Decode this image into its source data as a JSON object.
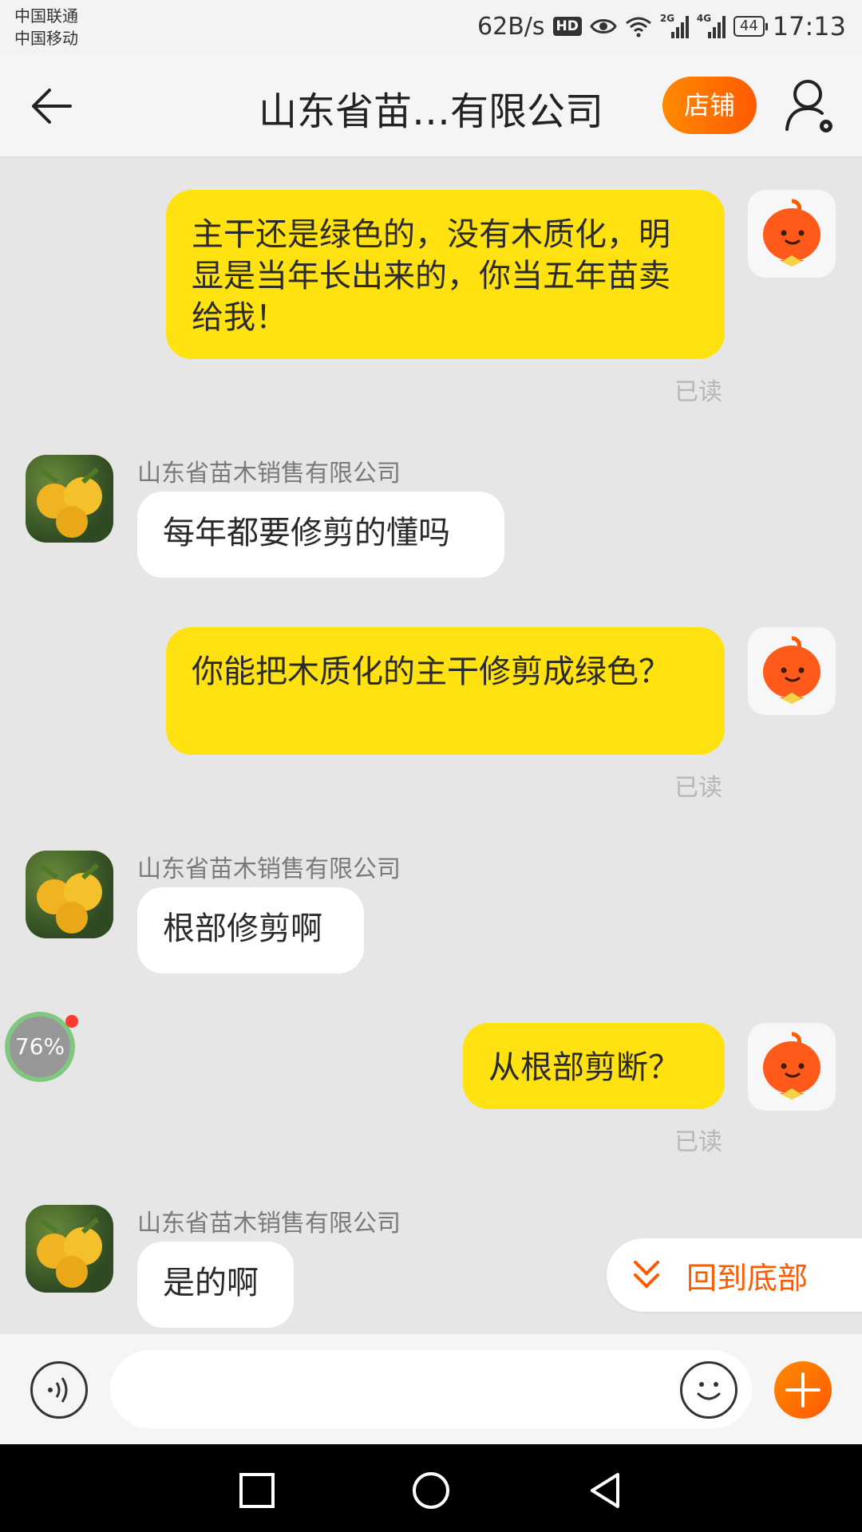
{
  "status_bar": {
    "carrier_1": "中国联通",
    "carrier_2": "中国移动",
    "net_speed": "62B/s",
    "hd_badge": "HD",
    "sig_tag_2g": "2G",
    "sig_tag_4g": "4G",
    "battery_level": "44",
    "time": "17:13"
  },
  "header": {
    "title": "山东省苗…有限公司",
    "shop_button": "店铺",
    "icons": {
      "back": "arrow-left",
      "user_settings": "user-gear"
    }
  },
  "chat": {
    "messages": [
      {
        "from": "self",
        "text": "主干还是绿色的，没有木质化，明显是当年长出来的，你当五年苗卖给我！",
        "status": "已读"
      },
      {
        "from": "other",
        "sender": "山东省苗木销售有限公司",
        "text": "每年都要修剪的懂吗"
      },
      {
        "from": "self",
        "text": "你能把木质化的主干修剪成绿色？",
        "status": "已读"
      },
      {
        "from": "other",
        "sender": "山东省苗木销售有限公司",
        "text": "根部修剪啊"
      },
      {
        "from": "self",
        "text": "从根部剪断？",
        "status": "已读"
      },
      {
        "from": "other",
        "sender": "山东省苗木销售有限公司",
        "text": "是的啊"
      }
    ]
  },
  "floating_progress": {
    "label": "76%",
    "value": 0.76
  },
  "back_to_bottom": {
    "label": "回到底部"
  },
  "input_bar": {
    "input_value": "",
    "icons": [
      "voice",
      "emoji",
      "add"
    ]
  },
  "colors": {
    "accent": "#ff6a00",
    "self_bubble": "#ffe20f",
    "other_bubble": "#ffffff",
    "background": "#e6e6e6"
  }
}
